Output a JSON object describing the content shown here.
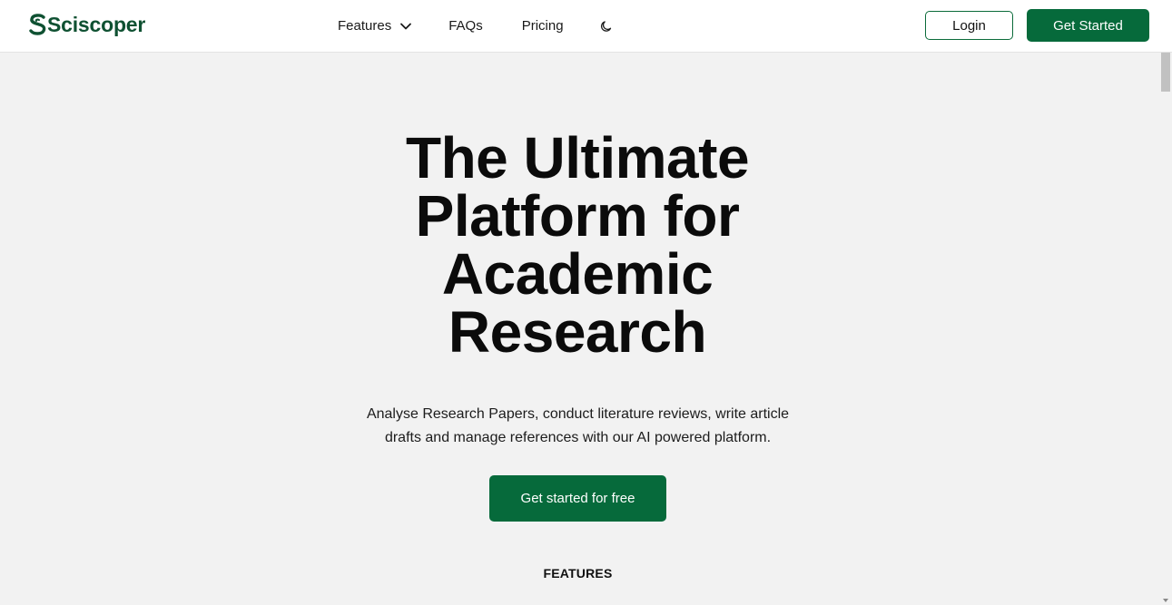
{
  "header": {
    "logo_text": "Sciscoper",
    "nav": [
      {
        "label": "Features"
      },
      {
        "label": "FAQs"
      },
      {
        "label": "Pricing"
      }
    ],
    "login_label": "Login",
    "get_started_label": "Get Started"
  },
  "hero": {
    "title_lines": [
      "The Ultimate",
      "Platform for",
      "Academic",
      "Research"
    ],
    "subtitle_lines": [
      "Analyse Research Papers, conduct literature reviews, write article",
      "drafts and manage references with our AI powered platform."
    ],
    "cta_label": "Get started for free"
  },
  "features_section": {
    "label": "FEATURES"
  },
  "icons": {
    "logo": "sciscoper-logo-icon",
    "dropdown": "chevron-down-icon",
    "theme_toggle": "moon-icon"
  },
  "colors": {
    "brand_green": "#066a3b",
    "logo_green": "#0f5132",
    "background": "#f2f2f2",
    "header_bg": "#ffffff"
  }
}
